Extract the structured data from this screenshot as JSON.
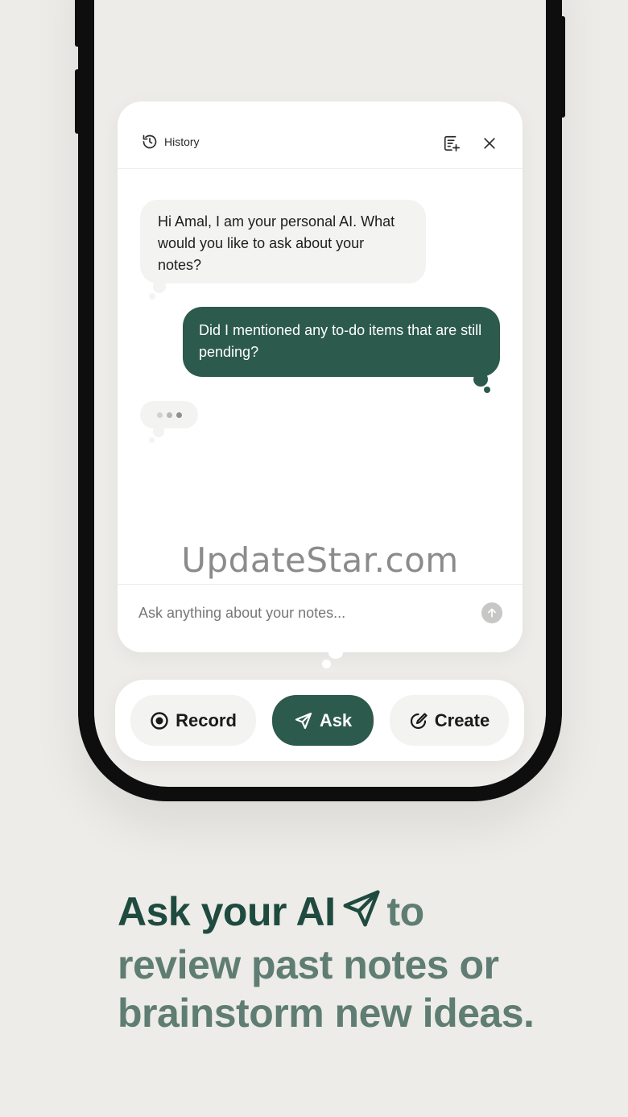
{
  "header": {
    "history_label": "History",
    "icons": {
      "history": "history-clock-icon",
      "new_note": "note-add-icon",
      "close": "close-icon"
    }
  },
  "chat": {
    "ai_message": "Hi Amal, I am your personal AI. What would you like to ask about your notes?",
    "user_message": "Did I mentioned any to-do items that are still pending?"
  },
  "watermark": "UpdateStar.com",
  "input": {
    "placeholder": "Ask anything about your notes..."
  },
  "actions": {
    "record_label": "Record",
    "ask_label": "Ask",
    "create_label": "Create"
  },
  "caption": {
    "line1_dark": "Ask your AI",
    "line1_light": "to",
    "line2": "review past notes or",
    "line3": "brainstorm new ideas."
  },
  "colors": {
    "accent": "#2c5a4c",
    "background": "#edece8",
    "caption_dark": "#1f4a3f",
    "caption_light": "#5f7d72",
    "ai_bubble": "#f3f3f2"
  }
}
